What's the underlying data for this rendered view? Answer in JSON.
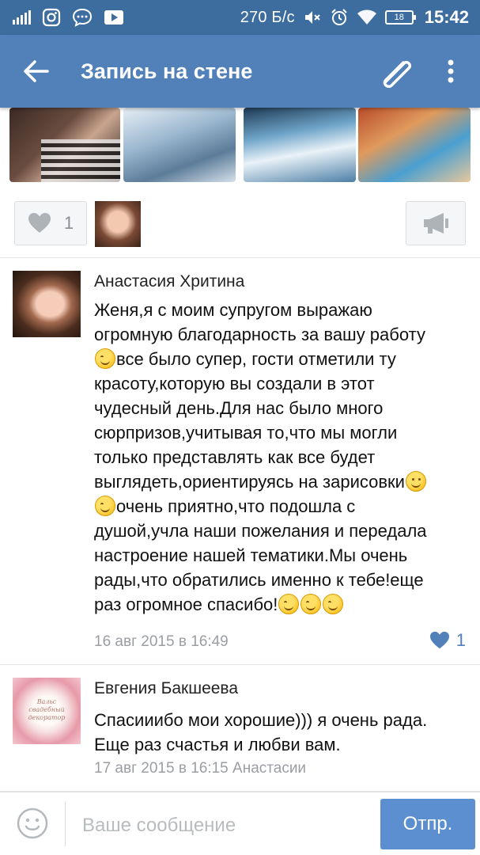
{
  "status_bar": {
    "speed": "270 Б/с",
    "battery": "18",
    "time": "15:42",
    "icons": [
      "signal-icon",
      "instagram-icon",
      "chat-icon",
      "youtube-icon",
      "mute-icon",
      "alarm-icon",
      "wifi-icon",
      "battery-icon"
    ]
  },
  "app_bar": {
    "title": "Запись на стене",
    "icons": [
      "back-arrow-icon",
      "paperclip-icon",
      "more-vert-icon"
    ]
  },
  "post_actions": {
    "like_count": "1"
  },
  "comments": [
    {
      "author": "Анастасия Хритина",
      "text_lines": [
        "Женя,я с моим супругом выражаю",
        "огромную благодарность за вашу работу",
        "все было супер, гости отметили ту",
        "красоту,которую вы создали в этот",
        "чудесный день.Для нас было много",
        "сюрпризов,учитывая то,что мы могли",
        "только представлять как все будет",
        "выглядеть,ориентируясь на зарисовки",
        "очень приятно,что подошла с",
        "душой,учла наши пожелания и передала",
        "настроение нашей тематики.Мы очень",
        "рады,что обратились именно к тебе!еще",
        "раз огромное спасибо!"
      ],
      "date": "16 авг 2015 в 16:49",
      "likes": "1"
    },
    {
      "author": "Евгения Бакшеева",
      "avatar_caption": "Вальс свадебный декоратор",
      "text_lines": [
        "Спасииибо мои хорошие))) я очень рада.",
        "Еще раз счастья и любви вам."
      ],
      "date": "17 авг 2015 в 16:15 Анастасии"
    }
  ],
  "composer": {
    "placeholder": "Ваше сообщение",
    "send_label": "Отпр."
  },
  "colors": {
    "status_bar": "#3d6c9e",
    "app_bar": "#5181b8",
    "send_button": "#5c8fd0",
    "meta_text": "#9a9ea3"
  }
}
